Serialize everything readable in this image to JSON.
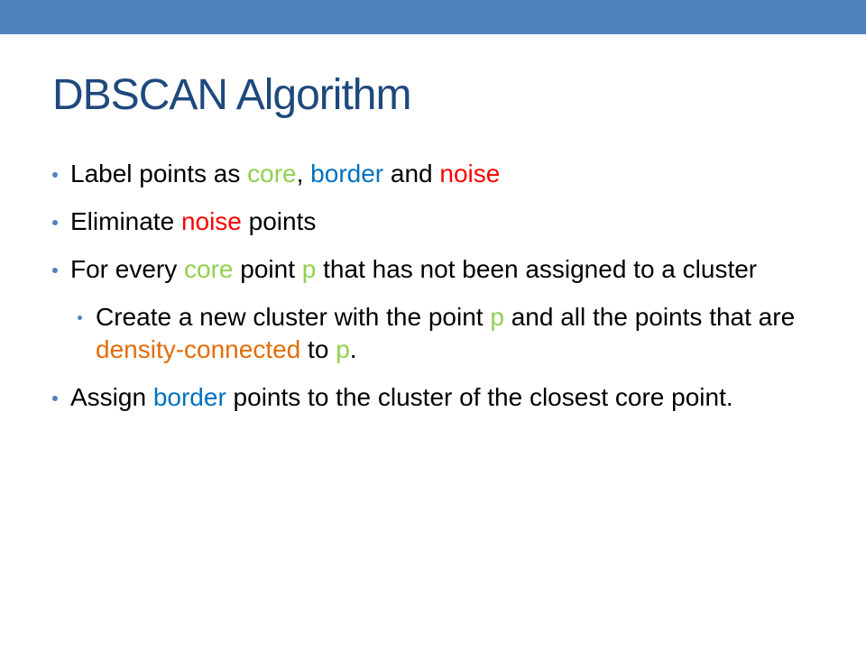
{
  "slide": {
    "title": "DBSCAN Algorithm",
    "bullets": [
      {
        "level": 1,
        "segments": [
          {
            "text": "Label points as ",
            "color": "#000000"
          },
          {
            "text": "core",
            "color": "#92d050"
          },
          {
            "text": ", ",
            "color": "#000000"
          },
          {
            "text": "border",
            "color": "#0070c0"
          },
          {
            "text": " and ",
            "color": "#000000"
          },
          {
            "text": "noise",
            "color": "#ff0000"
          }
        ]
      },
      {
        "level": 1,
        "segments": [
          {
            "text": "Eliminate ",
            "color": "#000000"
          },
          {
            "text": "noise",
            "color": "#ff0000"
          },
          {
            "text": " points",
            "color": "#000000"
          }
        ]
      },
      {
        "level": 1,
        "segments": [
          {
            "text": "For every ",
            "color": "#000000"
          },
          {
            "text": "core",
            "color": "#92d050"
          },
          {
            "text": " point ",
            "color": "#000000"
          },
          {
            "text": "p",
            "color": "#92d050"
          },
          {
            "text": " that has not been assigned to a cluster",
            "color": "#000000"
          }
        ]
      },
      {
        "level": 2,
        "segments": [
          {
            "text": "Create a new cluster with the point ",
            "color": "#000000"
          },
          {
            "text": "p",
            "color": "#92d050"
          },
          {
            "text": " and all the points that are ",
            "color": "#000000"
          },
          {
            "text": "density-connected",
            "color": "#e36c09"
          },
          {
            "text": " to ",
            "color": "#000000"
          },
          {
            "text": "p",
            "color": "#92d050"
          },
          {
            "text": ".",
            "color": "#000000"
          }
        ]
      },
      {
        "level": 1,
        "segments": [
          {
            "text": "Assign ",
            "color": "#000000"
          },
          {
            "text": "border",
            "color": "#0070c0"
          },
          {
            "text": " points to the cluster of  the closest core point.",
            "color": "#000000"
          }
        ]
      }
    ]
  },
  "colors": {
    "top_bar": "#4f81bd",
    "title": "#1f497d",
    "bullet_dot": "#4f81bd",
    "core": "#92d050",
    "border": "#0070c0",
    "noise": "#ff0000",
    "density_connected": "#e36c09"
  }
}
